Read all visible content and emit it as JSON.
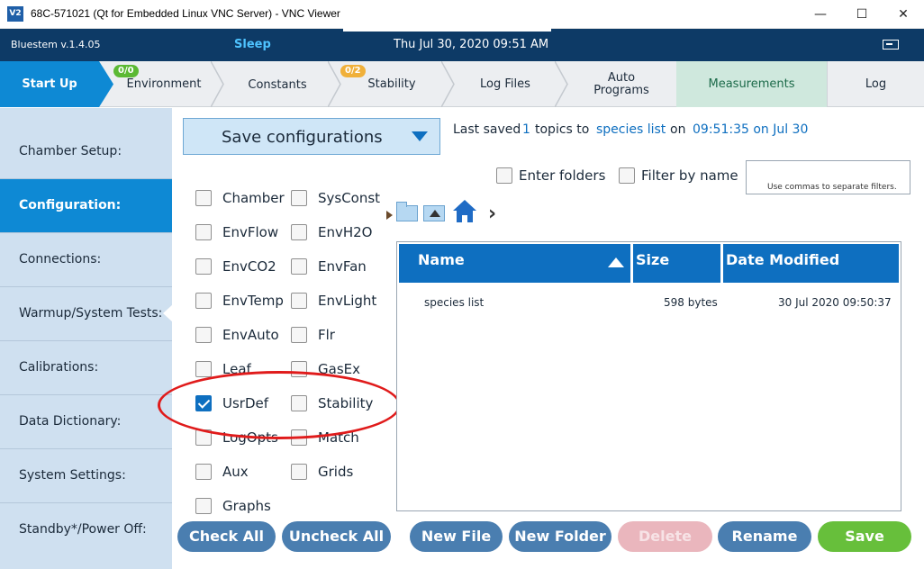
{
  "window": {
    "title": "68C-571021 (Qt for Embedded Linux VNC Server) - VNC Viewer",
    "logo_text": "V2",
    "controls": {
      "minimize": "—",
      "maximize": "☐",
      "close": "✕"
    }
  },
  "appbar": {
    "version": "Bluestem v.1.4.05",
    "status": "Sleep",
    "datetime": "Thu Jul 30, 2020 09:51 AM"
  },
  "tabs": [
    {
      "label": "Start Up",
      "active": true
    },
    {
      "label": "Environment",
      "badge": "0/0"
    },
    {
      "label": "Constants"
    },
    {
      "label": "Stability",
      "badge": "0/2"
    },
    {
      "label": "Log Files"
    },
    {
      "label_line1": "Auto",
      "label_line2": "Programs"
    },
    {
      "label": "Measurements"
    },
    {
      "label": "Log"
    }
  ],
  "sidebar": [
    {
      "label": "Chamber Setup:"
    },
    {
      "label": "Configuration:",
      "active": true
    },
    {
      "label": "Connections:"
    },
    {
      "label": "Warmup/System Tests:"
    },
    {
      "label": "Calibrations:"
    },
    {
      "label": "Data Dictionary:"
    },
    {
      "label": "System Settings:"
    },
    {
      "label": "Standby*/Power Off:"
    }
  ],
  "config": {
    "dropdown_label": "Save configurations",
    "last_saved": {
      "prefix": "Last saved",
      "count": "1",
      "mid": "topics to",
      "target": "species list",
      "on": "on",
      "time": "09:51:35 on Jul 30"
    },
    "options": {
      "enter_folders": "Enter folders",
      "filter_by_name": "Filter by name",
      "filter_placeholder": "Use commas to separate filters."
    },
    "groups_left": [
      {
        "label": "Chamber",
        "checked": false
      },
      {
        "label": "EnvFlow",
        "checked": false
      },
      {
        "label": "EnvCO2",
        "checked": false
      },
      {
        "label": "EnvTemp",
        "checked": false
      },
      {
        "label": "EnvAuto",
        "checked": false
      },
      {
        "label": "Leaf",
        "checked": false
      },
      {
        "label": "UsrDef",
        "checked": true
      },
      {
        "label": "LogOpts",
        "checked": false
      },
      {
        "label": "Aux",
        "checked": false
      },
      {
        "label": "Graphs",
        "checked": false
      }
    ],
    "groups_right": [
      {
        "label": "SysConst",
        "checked": false
      },
      {
        "label": "EnvH2O",
        "checked": false
      },
      {
        "label": "EnvFan",
        "checked": false
      },
      {
        "label": "EnvLight",
        "checked": false
      },
      {
        "label": "Flr",
        "checked": false
      },
      {
        "label": "GasEx",
        "checked": false
      },
      {
        "label": "Stability",
        "checked": false
      },
      {
        "label": "Match",
        "checked": false
      },
      {
        "label": "Grids",
        "checked": false
      }
    ]
  },
  "filetable": {
    "columns": {
      "name": "Name",
      "size": "Size",
      "date": "Date Modified"
    },
    "sort": "ascending",
    "rows": [
      {
        "name": "species list",
        "size": "598 bytes",
        "date": "30 Jul 2020 09:50:37"
      }
    ]
  },
  "buttons": {
    "check_all": "Check All",
    "uncheck_all": "Uncheck All",
    "new_file": "New File",
    "new_folder": "New Folder",
    "delete": "Delete",
    "rename": "Rename",
    "save": "Save"
  },
  "colors": {
    "header_bg": "#0d3a66",
    "accent": "#0e89d4",
    "annotation": "#e01b1b",
    "save_button": "#67bf3b"
  }
}
